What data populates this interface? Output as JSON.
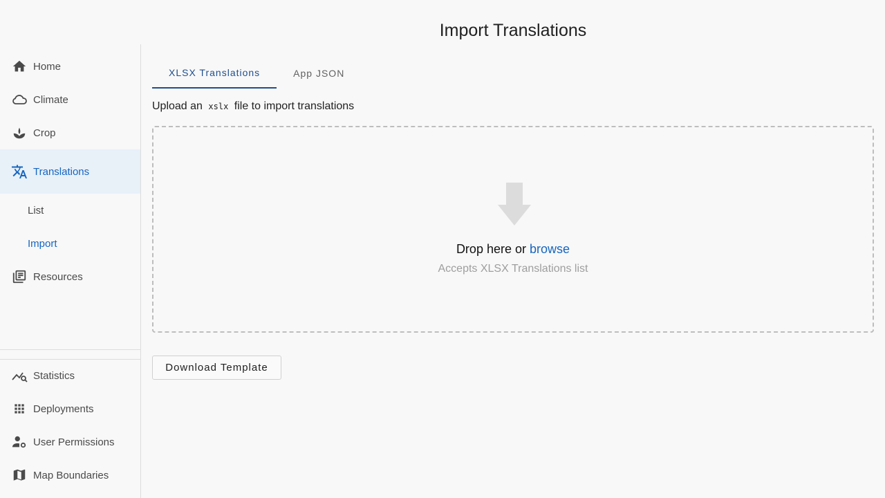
{
  "page": {
    "title": "Import Translations"
  },
  "sidebar": {
    "main_items": [
      {
        "label": "Home",
        "icon": "home-icon"
      },
      {
        "label": "Climate",
        "icon": "cloud-icon"
      },
      {
        "label": "Crop",
        "icon": "sprout-icon"
      },
      {
        "label": "Translations",
        "icon": "translate-icon",
        "active": true
      },
      {
        "label": "Resources",
        "icon": "library-icon"
      }
    ],
    "sub_items": [
      {
        "label": "List"
      },
      {
        "label": "Import",
        "active": true
      }
    ],
    "bottom_items": [
      {
        "label": "Statistics",
        "icon": "chart-search-icon"
      },
      {
        "label": "Deployments",
        "icon": "grid-icon"
      },
      {
        "label": "User Permissions",
        "icon": "user-gear-icon"
      },
      {
        "label": "Map Boundaries",
        "icon": "map-icon"
      }
    ]
  },
  "tabs": [
    {
      "label": "XLSX Translations",
      "active": true
    },
    {
      "label": "App JSON"
    }
  ],
  "upload": {
    "prefix": "Upload an",
    "code": "xslx",
    "suffix": "file to import translations"
  },
  "dropzone": {
    "main_text": "Drop here or",
    "browse_link": "browse",
    "sub_text": "Accepts XLSX Translations list"
  },
  "actions": {
    "download_label": "Download Template"
  },
  "colors": {
    "accent": "#1565c0",
    "active_bg": "#e8f0f8",
    "tab_active": "#1f4e8c"
  }
}
